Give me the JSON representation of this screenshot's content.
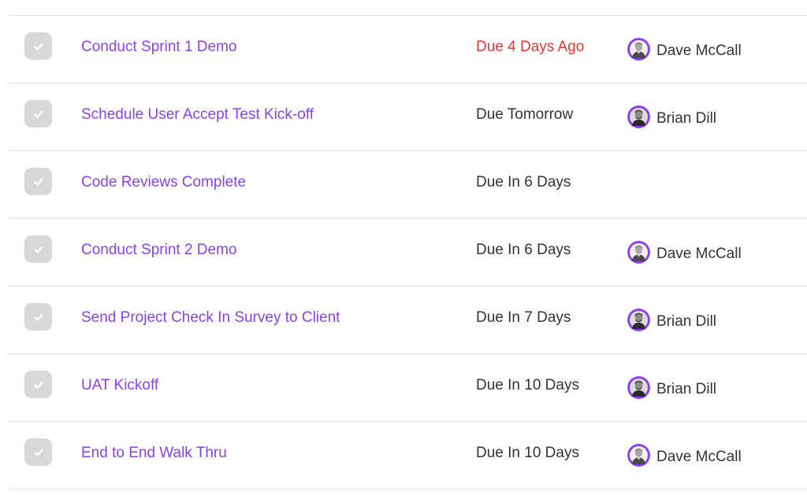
{
  "colors": {
    "task_link": "#8a3ff0",
    "overdue": "#ee3333",
    "text": "#333333",
    "checkbox_bg": "#d8d8d8",
    "avatar_ring": "#8a3ff0"
  },
  "tasks": [
    {
      "title": "Conduct Sprint 1 Demo",
      "due": "Due 4 Days Ago",
      "overdue": true,
      "assignee": "Dave McCall",
      "avatar": "dave"
    },
    {
      "title": "Schedule User Accept Test Kick-off",
      "due": "Due Tomorrow",
      "overdue": false,
      "assignee": "Brian Dill",
      "avatar": "brian"
    },
    {
      "title": "Code Reviews Complete",
      "due": "Due In 6 Days",
      "overdue": false,
      "assignee": "",
      "avatar": ""
    },
    {
      "title": "Conduct Sprint 2 Demo",
      "due": "Due In 6 Days",
      "overdue": false,
      "assignee": "Dave McCall",
      "avatar": "dave"
    },
    {
      "title": "Send Project Check In Survey to Client",
      "due": "Due In 7 Days",
      "overdue": false,
      "assignee": "Brian Dill",
      "avatar": "brian"
    },
    {
      "title": "UAT Kickoff",
      "due": "Due In 10 Days",
      "overdue": false,
      "assignee": "Brian Dill",
      "avatar": "brian"
    },
    {
      "title": "End to End Walk Thru",
      "due": "Due In 10 Days",
      "overdue": false,
      "assignee": "Dave McCall",
      "avatar": "dave"
    }
  ]
}
